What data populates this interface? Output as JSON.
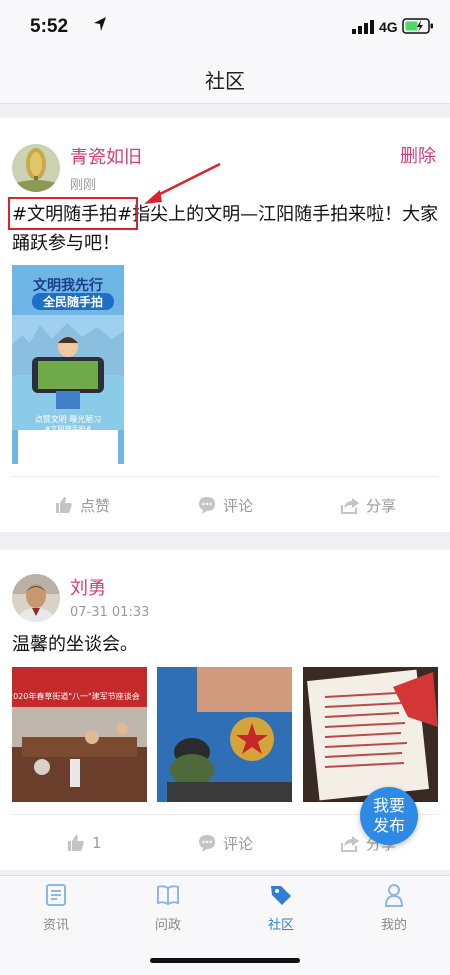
{
  "status_bar": {
    "time": "5:52",
    "network": "4G"
  },
  "nav": {
    "title": "社区"
  },
  "posts": [
    {
      "username": "青瓷如旧",
      "time": "刚刚",
      "delete_label": "删除",
      "text": "#文明随手拍#指尖上的文明—江阳随手拍来啦！大家踊跃参与吧！",
      "poster": {
        "headline_1": "文明我先行",
        "headline_2": "全民随手拍",
        "caption_1": "点赞文明  曝光陋习",
        "caption_2": "#文明随手拍#"
      },
      "actions": {
        "like": "点赞",
        "comment": "评论",
        "share": "分享"
      }
    },
    {
      "username": "刘勇",
      "time": "07-31 01:33",
      "text": "温馨的坐谈会。",
      "image_banner_text": "2020年春草街道\"八一\"建军节座谈会",
      "actions": {
        "like": "1",
        "comment": "评论",
        "share": "分享"
      }
    }
  ],
  "fab_label": "我要\n发布",
  "tabs": [
    {
      "label": "资讯",
      "icon": "news-icon"
    },
    {
      "label": "问政",
      "icon": "book-icon"
    },
    {
      "label": "社区",
      "icon": "tag-icon",
      "active": true
    },
    {
      "label": "我的",
      "icon": "person-icon"
    }
  ],
  "colors": {
    "accent_pink": "#d23d7a",
    "accent_blue": "#2f8ae5",
    "annotation_red": "#d9232e"
  }
}
